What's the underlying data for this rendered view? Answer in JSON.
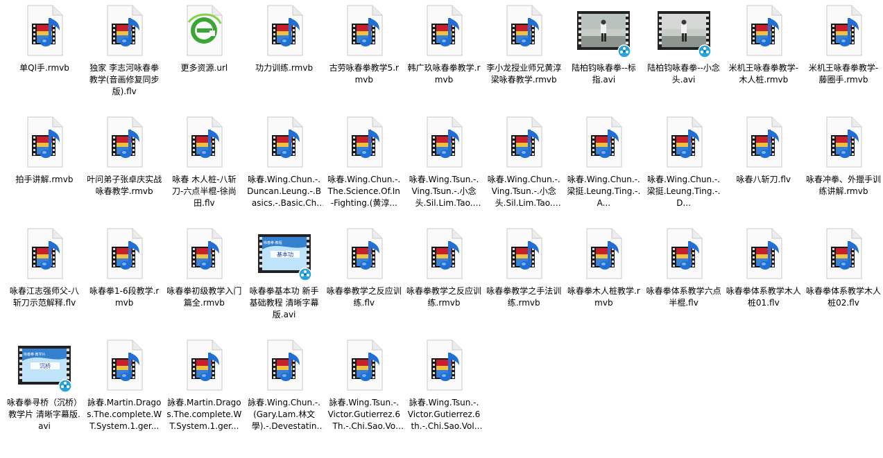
{
  "files": [
    {
      "name": "单Ql手.rmvb",
      "type": "video"
    },
    {
      "name": "独家 李志河咏春拳教学(音画修复同步版).flv",
      "type": "video"
    },
    {
      "name": "更多资源.url",
      "type": "url"
    },
    {
      "name": "功力训练.rmvb",
      "type": "video"
    },
    {
      "name": "古劳咏春拳教学5.rmvb",
      "type": "video"
    },
    {
      "name": "韩广玖咏春拳教学.rmvb",
      "type": "video"
    },
    {
      "name": "李小龙授业师兄黄淳梁咏春教学.rmvb",
      "type": "video"
    },
    {
      "name": "陆柏钧咏春拳--标指.avi",
      "type": "thumb-photo"
    },
    {
      "name": "陆柏钧咏春拳--小念头.avi",
      "type": "thumb-photo"
    },
    {
      "name": "米机王咏春拳教学-木人桩.rmvb",
      "type": "video"
    },
    {
      "name": "米机王咏春拳教学-藤圈手.rmvb",
      "type": "video"
    },
    {
      "name": "拍手讲解.rmvb",
      "type": "video"
    },
    {
      "name": "叶问弟子张卓庆实战咏春教学.rmvb",
      "type": "video"
    },
    {
      "name": "咏春 木人桩-八斩刀-六点半棍-徐尚田.flv",
      "type": "video"
    },
    {
      "name": "咏春.Wing.Chun.-.Duncan.Leung.-.Basics.-.Basic.Chi...",
      "type": "video"
    },
    {
      "name": "咏春.Wing.Chun.-.The.Science.Of.In-Fighting.(黄淳...",
      "type": "video"
    },
    {
      "name": "咏春.Wing.Tsun.-.Ving.Tsun.-.小念头.Sil.Lim.Tao.(徐...",
      "type": "video"
    },
    {
      "name": "咏春.Wing.Chun.-.Ving.Tsun.-.小念头.Sil.Lim.Tao.(徐...",
      "type": "video"
    },
    {
      "name": "咏春.Wing.Chun.-.梁挺.Leung.Ting.-.A...",
      "type": "video"
    },
    {
      "name": "咏春.Wing.Chun.-.梁挺.Leung.Ting.-.D...",
      "type": "video"
    },
    {
      "name": "咏春八斩刀.flv",
      "type": "video"
    },
    {
      "name": "咏春冲拳、外擸手训练讲解.rmvb",
      "type": "video"
    },
    {
      "name": "咏春江志强师父-八斩刀示范解释.flv",
      "type": "video"
    },
    {
      "name": "咏春拳1-6段教学.rmvb",
      "type": "video"
    },
    {
      "name": "咏春拳初级教学入门篇全.rmvb",
      "type": "video"
    },
    {
      "name": "咏春拳基本功 新手基础教程 清晰字幕版.avi",
      "type": "thumb-blue",
      "thumb_text": "基本功",
      "thumb_sub": "咏春拳·教程"
    },
    {
      "name": "咏春拳教学之反应训练.flv",
      "type": "video"
    },
    {
      "name": "咏春拳教学之反应训练.rmvb",
      "type": "video"
    },
    {
      "name": "咏春拳教学之手法训练.rmvb",
      "type": "video"
    },
    {
      "name": "咏春拳木人桩教学.rmvb",
      "type": "video"
    },
    {
      "name": "咏春拳体系教学六点半棍.flv",
      "type": "video"
    },
    {
      "name": "咏春拳体系教学木人桩01.flv",
      "type": "video"
    },
    {
      "name": "咏春拳体系教学木人桩02.flv",
      "type": "video"
    },
    {
      "name": "咏春拳寻桥（沉桥）教学片 清晰字幕版.avi",
      "type": "thumb-blue",
      "thumb_text": "沉桥",
      "thumb_sub": "咏春拳·教学片"
    },
    {
      "name": "詠春.Martin.Dragos.The.complete.WT.System.1.ger...",
      "type": "video"
    },
    {
      "name": "詠春.Martin.Dragos.The.complete.WT.System.1.ger...",
      "type": "video"
    },
    {
      "name": "詠春.Wing.Chun.-.(Gary.Lam.林文學).-.Devestating....",
      "type": "video"
    },
    {
      "name": "詠春.Wing.Tsun.-.Victor.Gutierrez.6Th.-.Chi.Sao.Vol....",
      "type": "video"
    },
    {
      "name": "詠春.Wing.Tsun.-.Victor.Gutierrez.6th.-.Chi.Sao.Vol.2...",
      "type": "video"
    }
  ]
}
